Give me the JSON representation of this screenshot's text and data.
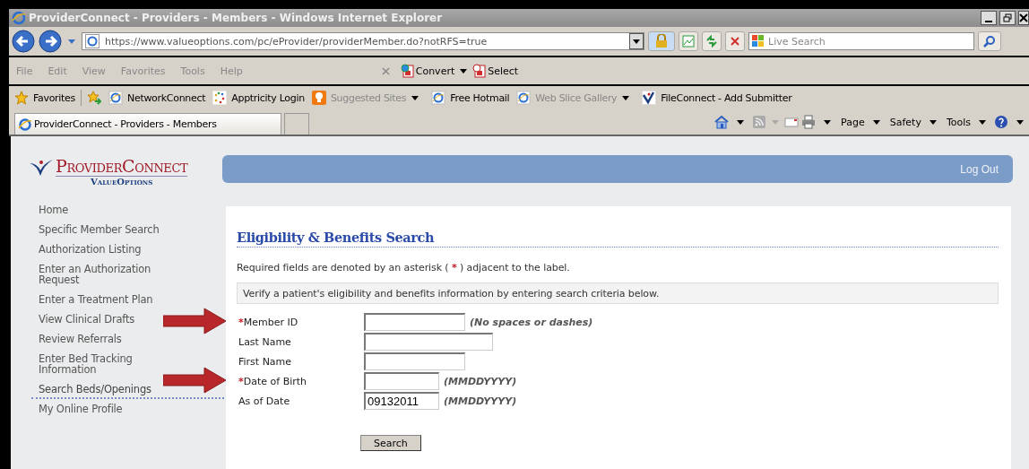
{
  "window": {
    "title": "ProviderConnect - Providers - Members - Windows Internet Explorer"
  },
  "address": {
    "url": "https://www.valueoptions.com/pc/eProvider/providerMember.do?notRFS=true"
  },
  "search": {
    "placeholder": "Live Search"
  },
  "menu": [
    "File",
    "Edit",
    "View",
    "Favorites",
    "Tools",
    "Help"
  ],
  "addon_buttons": [
    {
      "label": "Convert",
      "has_menu": true
    },
    {
      "label": "Select",
      "has_menu": false
    }
  ],
  "favorites": {
    "label": "Favorites",
    "items": [
      {
        "label": "NetworkConnect",
        "kind": "ie",
        "disabled": false,
        "has_menu": false
      },
      {
        "label": "Apptricity Login",
        "kind": "dots",
        "disabled": false,
        "has_menu": false
      },
      {
        "label": "Suggested Sites",
        "kind": "bulb",
        "disabled": true,
        "has_menu": true
      },
      {
        "label": "Free Hotmail",
        "kind": "ie",
        "disabled": false,
        "has_menu": false
      },
      {
        "label": "Web Slice Gallery",
        "kind": "ie",
        "disabled": true,
        "has_menu": true
      },
      {
        "label": "FileConnect - Add Submitter",
        "kind": "check",
        "disabled": false,
        "has_menu": false
      }
    ]
  },
  "tab": {
    "title": "ProviderConnect - Providers - Members"
  },
  "commands": [
    "Page",
    "Safety",
    "Tools"
  ],
  "site": {
    "logo": "ProviderConnect",
    "logo_sub": "ValueOptions",
    "logout": "Log Out"
  },
  "sidebar": {
    "items": [
      {
        "label": "Home",
        "selected": false
      },
      {
        "label": "Specific Member Search",
        "selected": false
      },
      {
        "label": "Authorization Listing",
        "selected": false
      },
      {
        "label": "Enter an Authorization Request",
        "selected": false
      },
      {
        "label": "Enter a Treatment Plan",
        "selected": false
      },
      {
        "label": "View Clinical Drafts",
        "selected": false
      },
      {
        "label": "Review Referrals",
        "selected": false
      },
      {
        "label": "Enter Bed Tracking Information",
        "selected": false
      },
      {
        "label": "Search Beds/Openings",
        "selected": true
      },
      {
        "label": "My Online Profile",
        "selected": false
      }
    ]
  },
  "form": {
    "heading": "Eligibility & Benefits Search",
    "note": {
      "before": "Required fields are denoted by an asterisk (",
      "asterisk": "*",
      "after": ") adjacent to the label."
    },
    "instructions": "Verify a patient's eligibility and benefits information by entering search criteria below.",
    "fields": [
      {
        "label": "Member ID",
        "required": true,
        "hint": "(No spaces or dashes)",
        "arrow": true
      },
      {
        "label": "Last Name",
        "required": false,
        "arrow": false
      },
      {
        "label": "First Name",
        "required": false,
        "arrow": false
      },
      {
        "label": "Date of Birth",
        "required": true,
        "hint": "(MMDDYYYY)",
        "arrow": true
      },
      {
        "label": "As of Date",
        "required": false,
        "value": "09132011",
        "hint": "(MMDDYYYY)",
        "arrow": false
      }
    ],
    "submit": "Search"
  }
}
